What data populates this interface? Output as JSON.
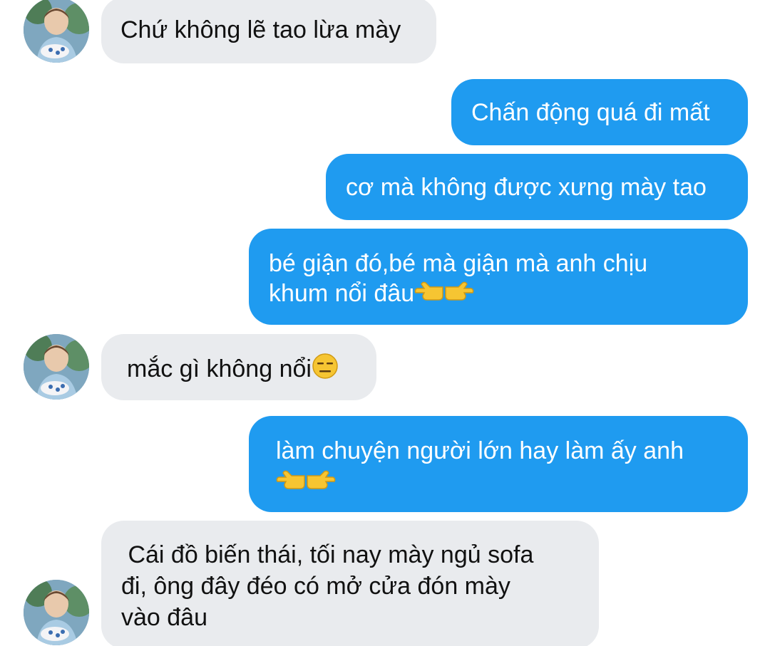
{
  "contact": {
    "avatar_icon": "contact-avatar-photo"
  },
  "colors": {
    "incoming_bubble": "#e9ebee",
    "outgoing_bubble": "#1f9bf0",
    "incoming_text": "#111111",
    "outgoing_text": "#ffffff"
  },
  "messages": [
    {
      "direction": "incoming",
      "text": "Chứ không lẽ tao lừa mày"
    },
    {
      "direction": "outgoing",
      "text": "Chấn động quá đi mất"
    },
    {
      "direction": "outgoing",
      "text": "cơ mà không được xưng mày tao"
    },
    {
      "direction": "outgoing",
      "line1": "bé giận đó,bé mà giận mà anh chịu",
      "line2": "khum nổi đâu",
      "emoji": [
        "backhand-index-left-icon",
        "backhand-index-right-icon"
      ]
    },
    {
      "direction": "incoming",
      "text": "mắc gì không nổi",
      "emoji": [
        "expressionless-face-icon"
      ]
    },
    {
      "direction": "outgoing",
      "line1": "làm chuyện người lớn hay làm ấy anh",
      "emoji": [
        "backhand-index-left-icon",
        "backhand-index-right-icon"
      ]
    },
    {
      "direction": "incoming",
      "line1": " Cái đồ biến thái, tối nay mày ngủ sofa",
      "line2": "đi, ông đây đéo có mở cửa đón mày",
      "line3": "vào đâu"
    }
  ]
}
